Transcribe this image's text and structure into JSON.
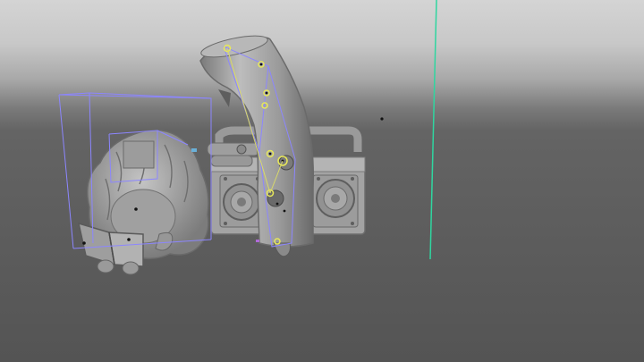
{
  "viewport": {
    "name": "3D viewport",
    "colors": {
      "sky_top": "#d2d2d2",
      "sky_mid": "#8c8c8c",
      "floor": "#575757",
      "bounding_box": "#8c86ff",
      "axis_line": "#2fd6a0",
      "selection_handle": "#e8e85a",
      "model_fill": "#a6a6a6",
      "model_shadow": "#6e6e6e"
    }
  },
  "scene_objects": [
    {
      "name": "character-figure",
      "icon": "figure-icon"
    },
    {
      "name": "pipe-tube",
      "icon": "pipe-icon"
    },
    {
      "name": "boombox",
      "icon": "speaker-icon"
    },
    {
      "name": "book",
      "icon": "book-icon"
    }
  ]
}
